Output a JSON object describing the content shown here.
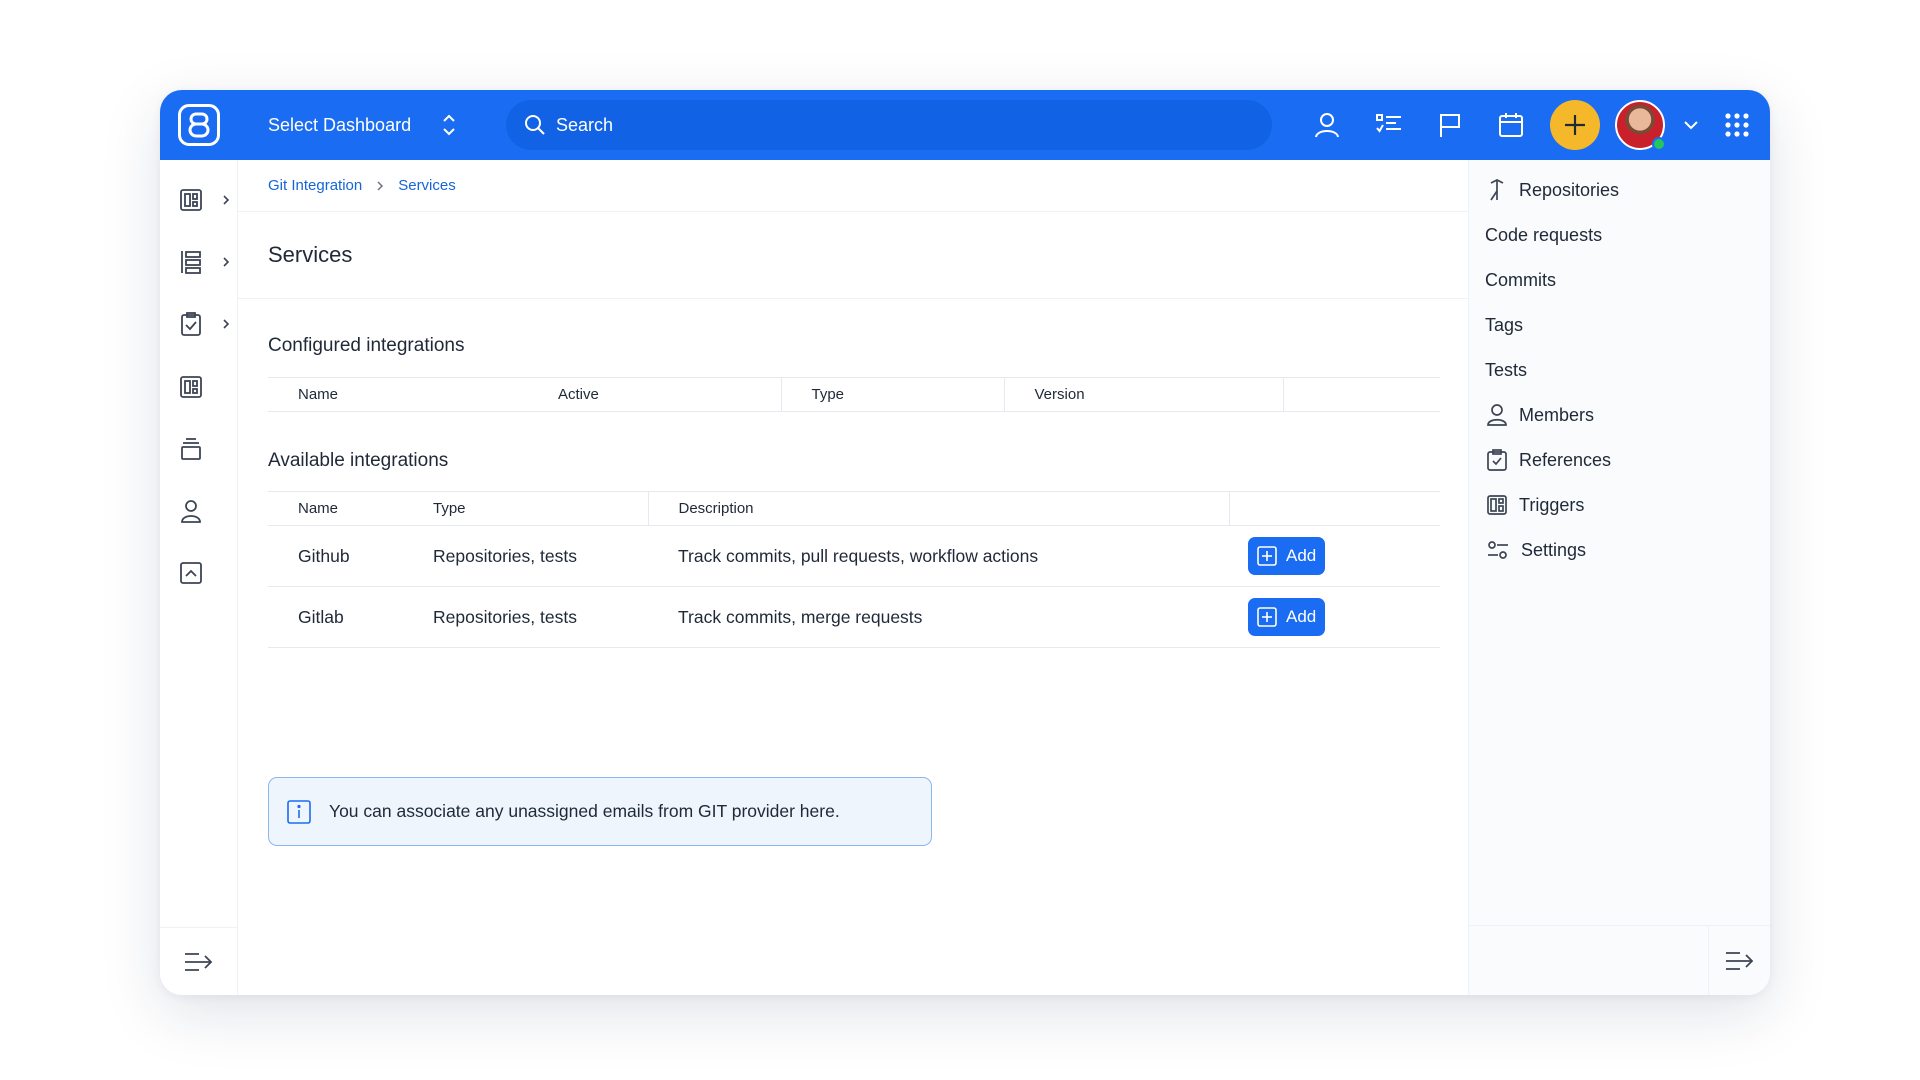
{
  "header": {
    "dashboard_select": "Select Dashboard",
    "search_placeholder": "Search"
  },
  "colors": {
    "brand": "#1a6cf2",
    "accent_plus": "#f6b82b",
    "status_online": "#22c55e"
  },
  "breadcrumb": {
    "parent": "Git Integration",
    "current": "Services"
  },
  "page": {
    "title": "Services"
  },
  "configured": {
    "title": "Configured integrations",
    "columns": [
      "Name",
      "Active",
      "Type",
      "Version"
    ]
  },
  "available": {
    "title": "Available integrations",
    "columns": [
      "Name",
      "Type",
      "Description"
    ],
    "rows": [
      {
        "name": "Github",
        "type": "Repositories, tests",
        "description": "Track commits, pull requests, workflow actions",
        "action": "Add"
      },
      {
        "name": "Gitlab",
        "type": "Repositories, tests",
        "description": "Track commits, merge requests",
        "action": "Add"
      }
    ]
  },
  "info": {
    "text": "You can associate any unassigned emails from GIT provider here."
  },
  "right_nav": {
    "items": [
      {
        "label": "Repositories",
        "icon": "repository-icon"
      },
      {
        "label": "Code requests",
        "icon": ""
      },
      {
        "label": "Commits",
        "icon": ""
      },
      {
        "label": "Tags",
        "icon": ""
      },
      {
        "label": "Tests",
        "icon": ""
      },
      {
        "label": "Members",
        "icon": "person-icon"
      },
      {
        "label": "References",
        "icon": "clipboard-icon"
      },
      {
        "label": "Triggers",
        "icon": "board-icon"
      },
      {
        "label": "Settings",
        "icon": "sliders-icon"
      }
    ]
  },
  "left_rail": {
    "items": [
      "dashboard-icon",
      "list-icon",
      "clipboard-check-icon",
      "board-icon",
      "stack-icon",
      "person-icon",
      "collapse-up-icon"
    ]
  }
}
